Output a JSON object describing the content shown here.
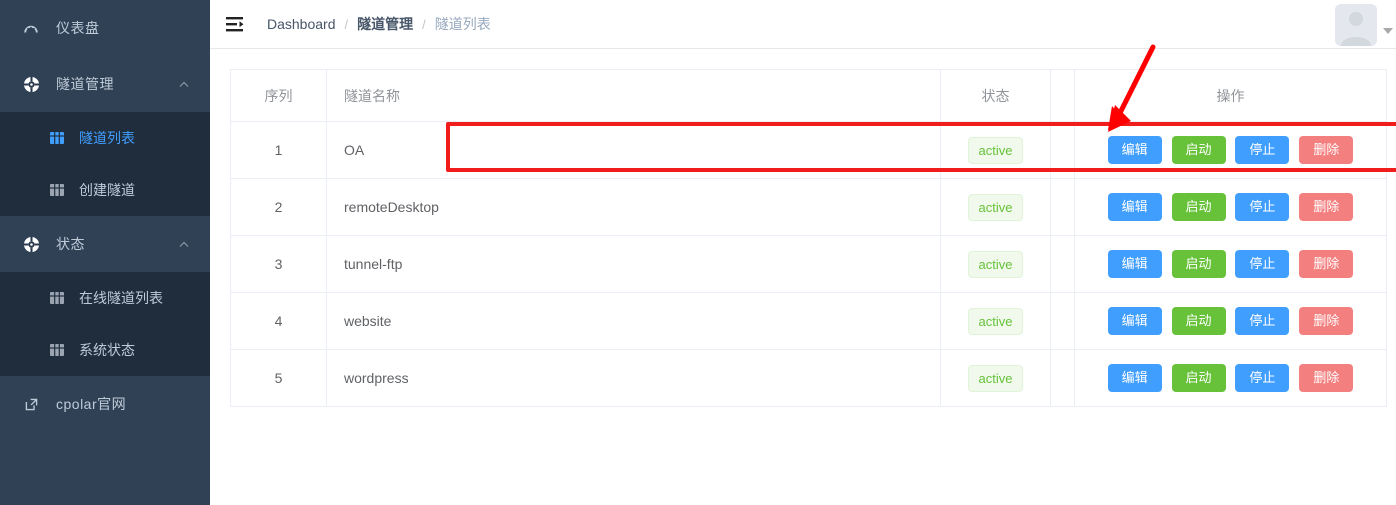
{
  "sidebar": {
    "items": [
      {
        "label": "仪表盘",
        "icon": "dashboard-icon",
        "type": "item"
      },
      {
        "label": "隧道管理",
        "icon": "tunnel-icon",
        "type": "group",
        "expanded": true,
        "arrow": "chevron-up-icon"
      },
      {
        "label": "状态",
        "icon": "status-icon",
        "type": "group",
        "expanded": true,
        "arrow": "chevron-up-icon"
      },
      {
        "label": "cpolar官网",
        "icon": "external-link-icon",
        "type": "item"
      }
    ],
    "tunnel_submenu": [
      {
        "label": "隧道列表",
        "icon": "table-icon",
        "active": true
      },
      {
        "label": "创建隧道",
        "icon": "table-icon",
        "active": false
      }
    ],
    "status_submenu": [
      {
        "label": "在线隧道列表",
        "icon": "table-icon",
        "active": false
      },
      {
        "label": "系统状态",
        "icon": "table-icon",
        "active": false
      }
    ]
  },
  "navbar": {
    "hamburger_icon": "menu-fold-icon",
    "breadcrumb": [
      {
        "label": "Dashboard",
        "style": "link"
      },
      {
        "label": "隧道管理",
        "style": "strong"
      },
      {
        "label": "隧道列表",
        "style": "current"
      }
    ],
    "separator": "/",
    "avatar_icon": "user-avatar-icon",
    "caret_icon": "caret-down-icon"
  },
  "table": {
    "headers": {
      "index": "序列",
      "name": "隧道名称",
      "status": "状态",
      "spacer": "",
      "operations": "操作"
    },
    "rows": [
      {
        "index": "1",
        "name": "OA",
        "status": "active",
        "highlighted": true
      },
      {
        "index": "2",
        "name": "remoteDesktop",
        "status": "active",
        "highlighted": false
      },
      {
        "index": "3",
        "name": "tunnel-ftp",
        "status": "active",
        "highlighted": false
      },
      {
        "index": "4",
        "name": "website",
        "status": "active",
        "highlighted": false
      },
      {
        "index": "5",
        "name": "wordpress",
        "status": "active",
        "highlighted": false
      }
    ],
    "actions": {
      "edit": "编辑",
      "start": "启动",
      "stop": "停止",
      "delete": "删除"
    }
  },
  "annotations": {
    "highlight_box_color": "#f11c1c",
    "arrow_color": "#fe0000",
    "target": "编辑"
  },
  "colors": {
    "sidebar_bg": "#304156",
    "submenu_bg": "#1f2d3d",
    "accent": "#409eff",
    "success": "#67c23a",
    "danger": "#f37f7f",
    "badge_text": "#67c23a",
    "badge_bg": "#f0f9eb"
  }
}
